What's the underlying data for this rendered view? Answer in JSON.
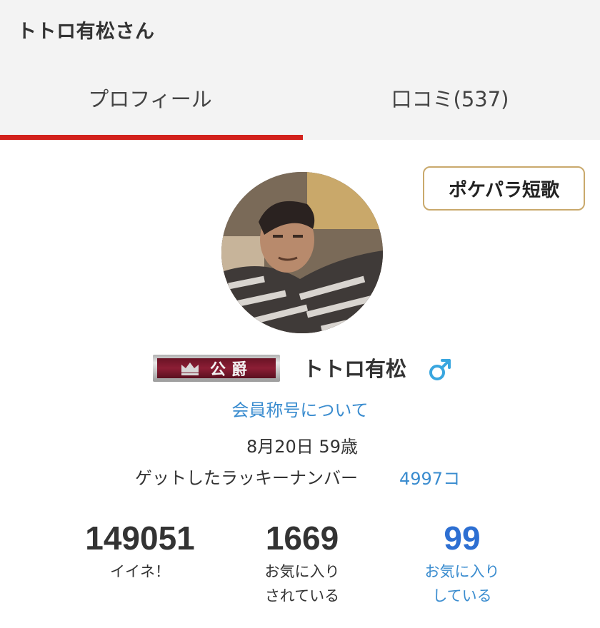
{
  "header": {
    "title": "トトロ有松さん"
  },
  "tabs": [
    {
      "label": "プロフィール",
      "active": true
    },
    {
      "label": "口コミ(537)",
      "active": false
    }
  ],
  "colors": {
    "accent": "#d2211c",
    "link": "#3a8ccf",
    "count_highlight": "#2d6fd2",
    "badge": "#8c1e35",
    "button_border": "#c9a96c",
    "male": "#39a6df"
  },
  "tanka_button": {
    "label": "ポケパラ短歌"
  },
  "profile": {
    "avatar_icon": "user-avatar-photo",
    "rank_badge": {
      "icon": "crown-icon",
      "label": "公爵"
    },
    "name": "トトロ有松",
    "gender_icon": "male-symbol-icon",
    "title_link": "会員称号について",
    "birth_age": "8月20日 59歳",
    "lucky_label": "ゲットしたラッキーナンバー",
    "lucky_value": "4997コ"
  },
  "stats": [
    {
      "value": "149051",
      "label_line1": "イイネ！",
      "label_line2": ""
    },
    {
      "value": "1669",
      "label_line1": "お気に入り",
      "label_line2": "されている"
    },
    {
      "value": "99",
      "label_line1": "お気に入り",
      "label_line2": "している"
    }
  ]
}
